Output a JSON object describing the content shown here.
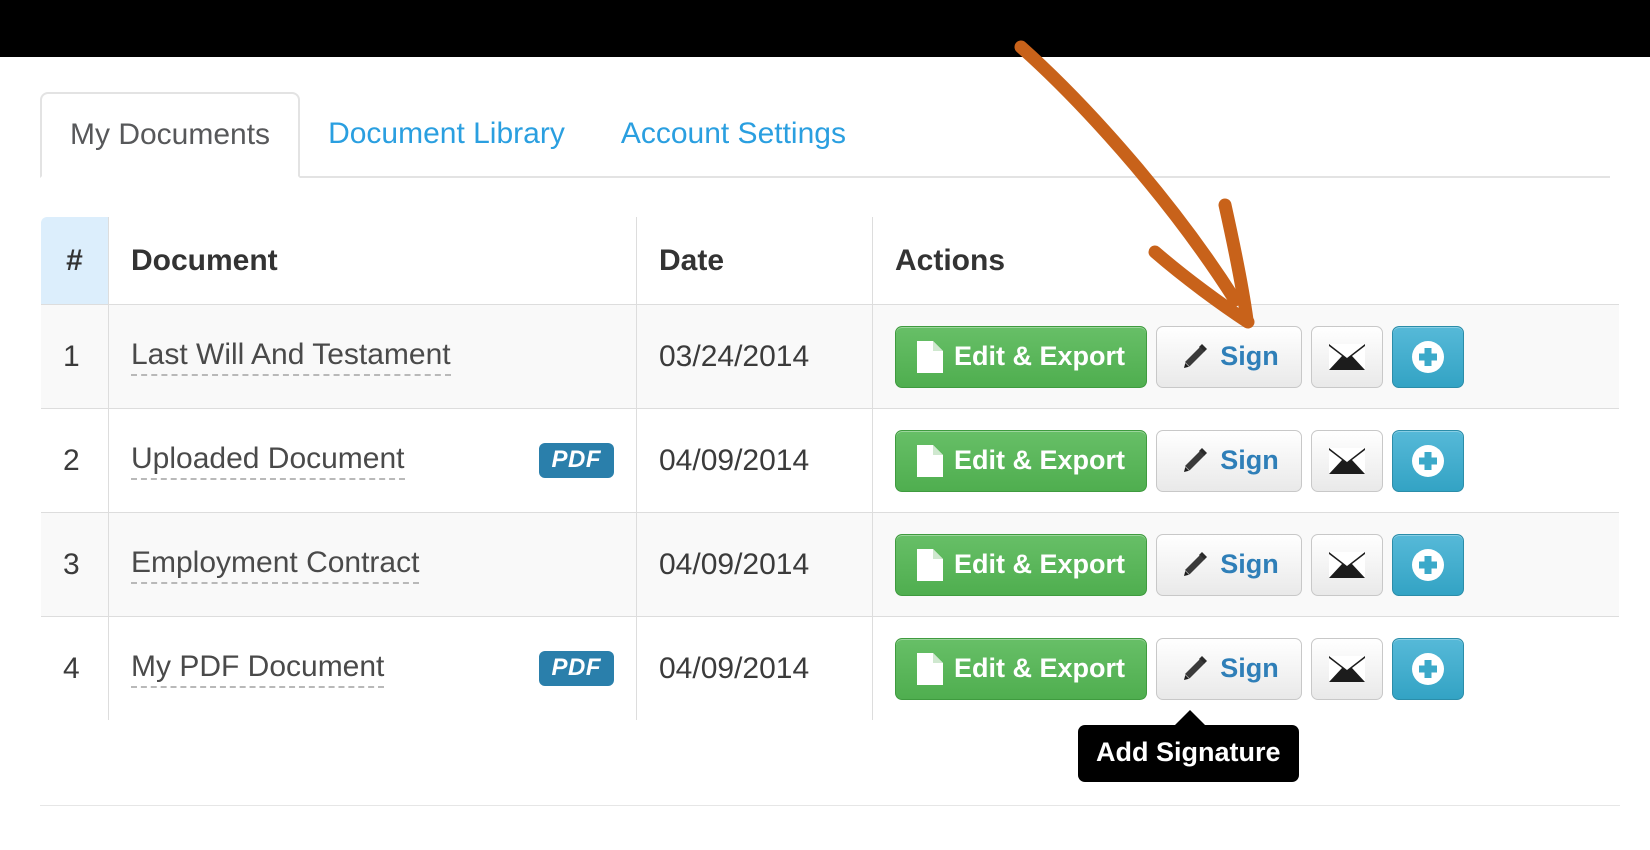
{
  "window": {
    "top_bar_color": "#000000"
  },
  "tabs": {
    "items": [
      {
        "label": "My Documents",
        "active": true
      },
      {
        "label": "Document Library",
        "active": false
      },
      {
        "label": "Account Settings",
        "active": false
      }
    ],
    "link_color": "#2a9fe0",
    "active_color": "#57585a"
  },
  "table": {
    "headers": {
      "num": "#",
      "document": "Document",
      "date": "Date",
      "actions": "Actions"
    },
    "num_header_bg": "#dceefc",
    "rows": [
      {
        "num": "1",
        "document": "Last Will And Testament",
        "badge": "",
        "date": "03/24/2014",
        "actions": {
          "edit_export": "Edit & Export",
          "sign": "Sign",
          "email_icon": "envelope-icon",
          "add_icon": "plus-circle-icon"
        }
      },
      {
        "num": "2",
        "document": "Uploaded Document",
        "badge": "PDF",
        "date": "04/09/2014",
        "actions": {
          "edit_export": "Edit & Export",
          "sign": "Sign",
          "email_icon": "envelope-icon",
          "add_icon": "plus-circle-icon"
        }
      },
      {
        "num": "3",
        "document": "Employment Contract",
        "badge": "",
        "date": "04/09/2014",
        "actions": {
          "edit_export": "Edit & Export",
          "sign": "Sign",
          "email_icon": "envelope-icon",
          "add_icon": "plus-circle-icon"
        }
      },
      {
        "num": "4",
        "document": "My PDF Document",
        "badge": "PDF",
        "date": "04/09/2014",
        "actions": {
          "edit_export": "Edit & Export",
          "sign": "Sign",
          "email_icon": "envelope-icon",
          "add_icon": "plus-circle-icon"
        }
      }
    ]
  },
  "tooltip": {
    "text": "Add Signature",
    "background": "#000000"
  },
  "annotation": {
    "arrow_color": "#c8621a",
    "description": "hand-drawn curved arrow pointing to the Sign button of row 1"
  },
  "colors": {
    "green_button": "#5cb85c",
    "blue_button": "#3ba9c9",
    "pdf_badge": "#2a7fab",
    "row_odd": "#f9f9f9",
    "row_even": "#ffffff",
    "border": "#dddddd"
  }
}
